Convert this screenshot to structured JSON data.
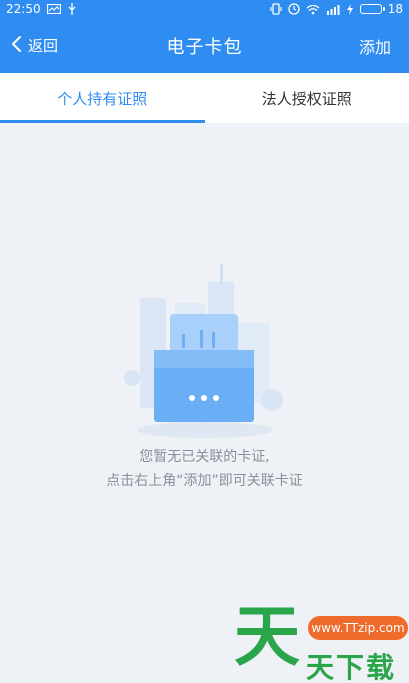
{
  "status_bar": {
    "time": "22:50",
    "battery": "18"
  },
  "app_bar": {
    "back_label": "返回",
    "title": "电子卡包",
    "add_label": "添加"
  },
  "tabs": [
    {
      "label": "个人持有证照",
      "active": true
    },
    {
      "label": "法人授权证照",
      "active": false
    }
  ],
  "empty_state": {
    "line1": "您暂无已关联的卡证,",
    "line2": "点击右上角“添加”即可关联卡证"
  },
  "watermark": {
    "big_char": "天",
    "url": "www.TTzip.com",
    "text": "天下载"
  },
  "colors": {
    "primary": "#2f8cf0",
    "background": "#eef1f5",
    "muted_text": "#8a8f99",
    "annotation_arrow": "#e53935",
    "watermark_green": "#2aa54a",
    "watermark_orange": "#ef6b2c"
  }
}
